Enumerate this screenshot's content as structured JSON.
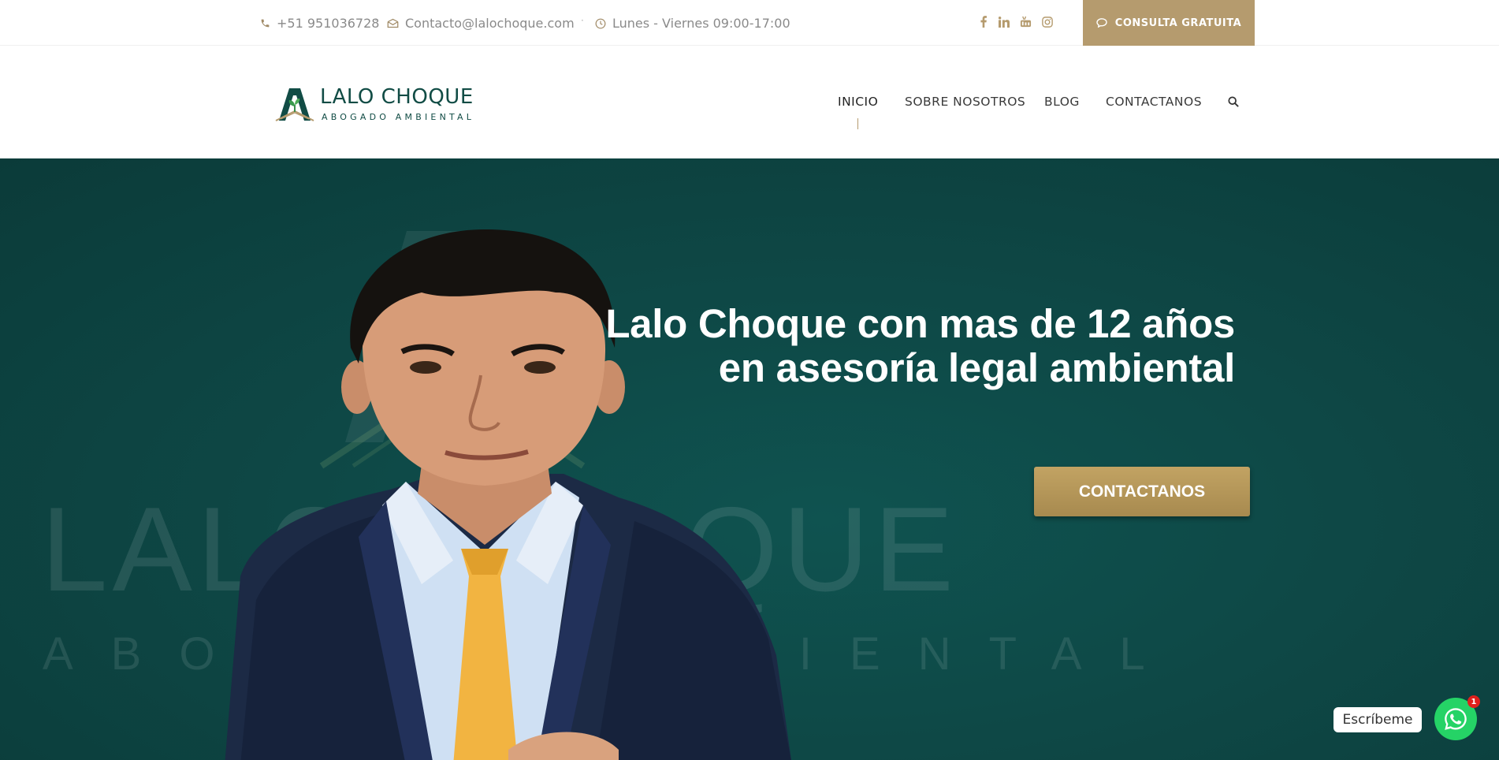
{
  "topbar": {
    "phone": "+51 951036728",
    "email": "Contacto@lalochoque.com",
    "hours": "Lunes - Viernes 09:00-17:00",
    "separator": "·",
    "social_icons": [
      "facebook-icon",
      "linkedin-icon",
      "youtube-icon",
      "instagram-icon"
    ],
    "cta_label": "CONSULTA GRATUITA"
  },
  "header": {
    "logo_title": "LALO CHOQUE",
    "logo_subtitle": "ABOGADO AMBIENTAL",
    "nav": [
      {
        "label": "INICIO",
        "active": true
      },
      {
        "label": "SOBRE NOSOTROS",
        "active": false
      },
      {
        "label": "BLOG",
        "active": false
      },
      {
        "label": "CONTACTANOS",
        "active": false
      }
    ],
    "search_icon": "search-icon"
  },
  "hero": {
    "bg_word_1": "LALO CHOQUE",
    "bg_word_2": "ABOGADO AMBIENTAL",
    "headline_line1": "Lalo Choque con mas de 12 años",
    "headline_line2": "en asesoría legal ambiental",
    "button_label": "CONTACTANOS"
  },
  "whatsapp": {
    "label": "Escríbeme",
    "badge_count": "1"
  },
  "colors": {
    "accent": "#b59b6e",
    "brand": "#114c45",
    "hero_bg": "#0e4846",
    "whatsapp": "#25d366"
  }
}
